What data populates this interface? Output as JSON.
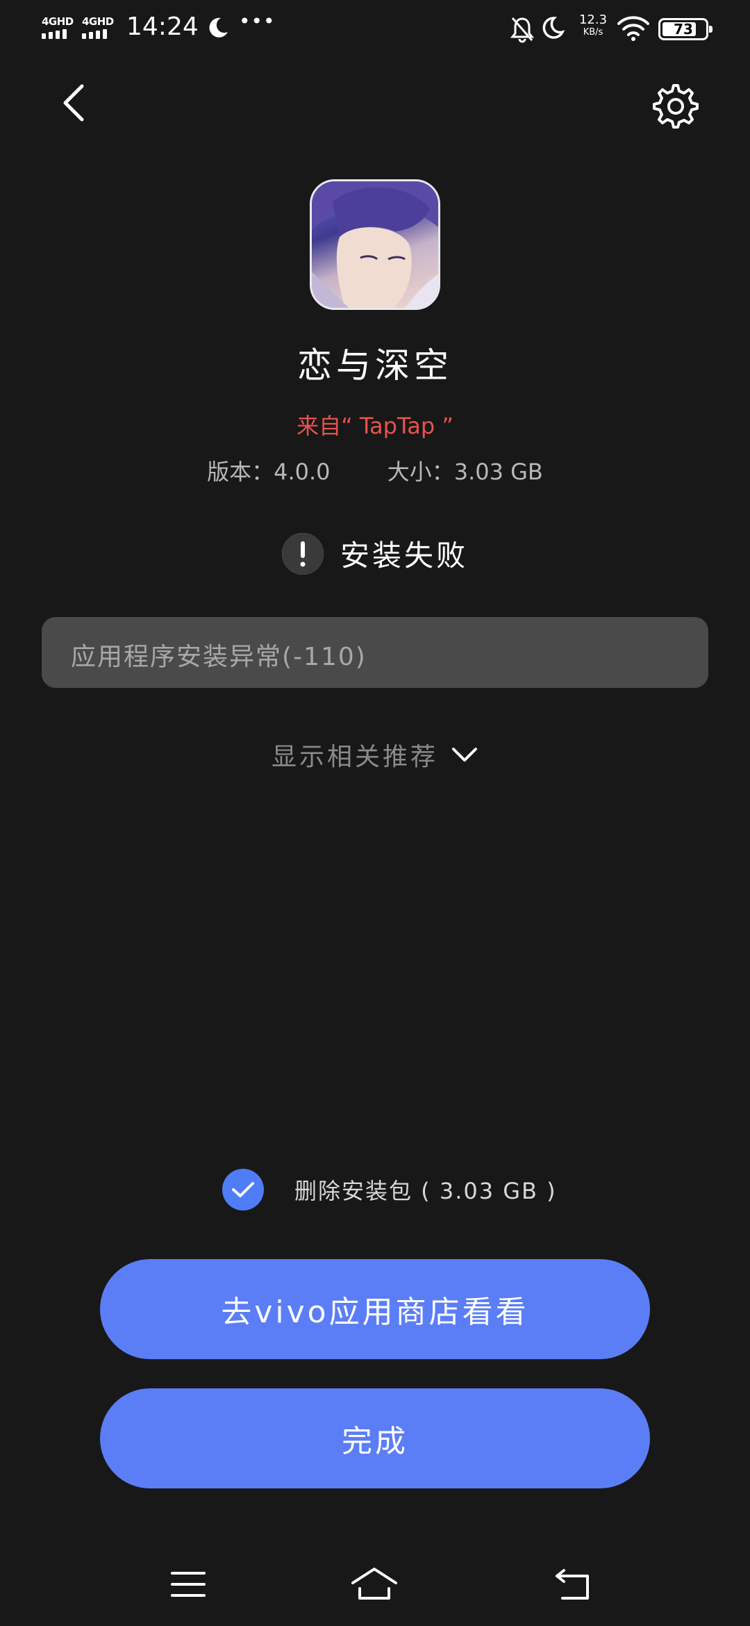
{
  "status_bar": {
    "signal1": "4GHD",
    "signal2": "4GHD",
    "time": "14:24",
    "more": "•••",
    "net_speed_value": "12.3",
    "net_speed_unit": "KB/s",
    "battery_level": "73",
    "icons": [
      "signal-icon",
      "moon-icon",
      "more-icon",
      "mute-bell-icon",
      "moon-icon",
      "wifi-icon",
      "battery-icon"
    ]
  },
  "nav": {
    "back_icon": "chevron-left-icon",
    "settings_icon": "gear-icon"
  },
  "app": {
    "name": "恋与深空",
    "source": "来自“ TapTap ”",
    "version": "版本：4.0.0",
    "size": "大小：3.03 GB"
  },
  "install": {
    "status": "安装失败",
    "error_message": "应用程序安装异常(-110)",
    "show_related": "显示相关推荐"
  },
  "delete_package": {
    "label": "删除安装包 ( 3.03 GB )",
    "checked": true
  },
  "buttons": {
    "store": "去vivo应用商店看看",
    "done": "完成"
  },
  "colors": {
    "background": "#181818",
    "accent": "#5b7ef6",
    "checkbox": "#4f7cf7",
    "source_red": "#e8524e",
    "error_box": "#4a4a4a"
  },
  "system_nav": [
    "menu-icon",
    "home-icon",
    "back-icon"
  ]
}
